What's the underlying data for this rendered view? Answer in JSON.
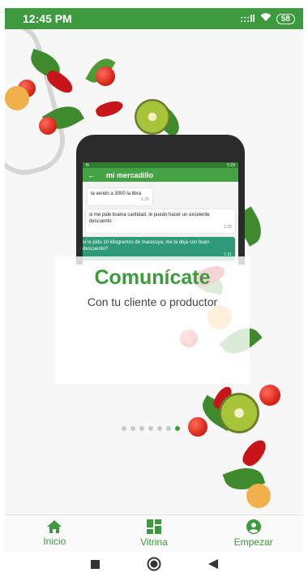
{
  "status_bar": {
    "time": "12:45 PM",
    "signal_glyph": ":::ll",
    "wifi_glyph": "▽",
    "battery": "58"
  },
  "phone_mock": {
    "status_time": "5:29",
    "status_left": "N",
    "app_title": "mi mercadillo",
    "back_glyph": "←",
    "messages": [
      {
        "text": "la vendo a 3000 la libra",
        "time": "1:25",
        "sent": false
      },
      {
        "text": "si me pide buena cantidad, le puedo hacer un excelente descuento",
        "time": "1:25",
        "sent": false
      },
      {
        "text": "si le pido 10 kilogramos de maracuya, me la deja con buen descuento?",
        "time": "1:31",
        "sent": true
      }
    ]
  },
  "slide": {
    "title": "Comunícate",
    "subtitle": "Con tu cliente o productor",
    "page_count": 7,
    "active_page": 7
  },
  "bottom_nav": {
    "items": [
      {
        "label": "Inicio",
        "icon": "home-icon"
      },
      {
        "label": "Vitrina",
        "icon": "dashboard-icon"
      },
      {
        "label": "Empezar",
        "icon": "account-circle-icon"
      }
    ]
  },
  "system_nav": {
    "items": [
      "square-icon",
      "circle-icon",
      "back-triangle-icon"
    ]
  },
  "colors": {
    "primary": "#3e9a3e",
    "sent_bubble": "#2f9a78"
  }
}
